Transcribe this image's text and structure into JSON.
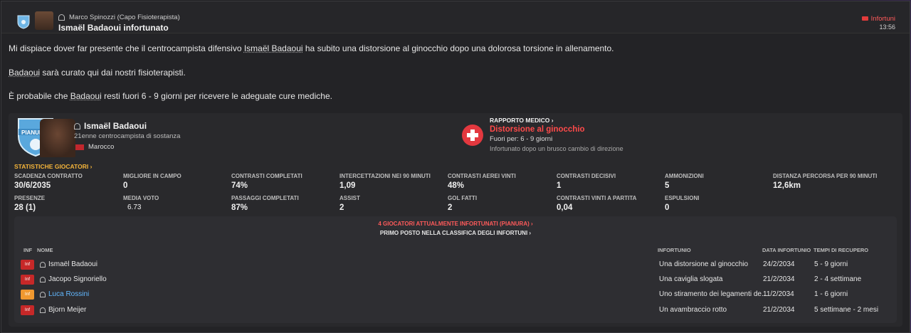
{
  "header": {
    "sender": "Marco Spinozzi  (Capo Fisioterapista)",
    "subject": "Ismaël Badaoui infortunato",
    "tag": "Infortuni",
    "time": "13:56"
  },
  "body": {
    "line1_a": "Mi dispiace dover far presente che il centrocampista difensivo ",
    "line1_name": "Ismaël Badaoui",
    "line1_b": " ha subito una distorsione al ginocchio dopo una dolorosa torsione in allenamento.",
    "line2_name": "Badaoui",
    "line2_b": " sarà curato qui dai nostri fisioterapisti.",
    "line3_a": "È probabile che ",
    "line3_name": "Badaoui",
    "line3_b": " resti fuori 6 - 9 giorni per ricevere le adeguate cure mediche."
  },
  "player": {
    "name": "Ismaël Badaoui",
    "description": "21enne centrocampista di sostanza",
    "nationality": "Marocco",
    "badge_text": "PIANURA"
  },
  "medical": {
    "title": "RAPPORTO MEDICO",
    "injury": "Distorsione al ginocchio",
    "out_for": "Fuori per: 6 - 9 giorni",
    "how": "Infortunato dopo un brusco cambio di direzione"
  },
  "stats": {
    "title": "STATISTICHE GIOCATORI",
    "items": [
      {
        "label": "SCADENZA CONTRATTO",
        "value": "30/6/2035"
      },
      {
        "label": "MIGLIORE IN CAMPO",
        "value": "0"
      },
      {
        "label": "CONTRASTI COMPLETATI",
        "value": "74%"
      },
      {
        "label": "INTERCETTAZIONI NEI 90 MINUTI",
        "value": "1,09"
      },
      {
        "label": "CONTRASTI AEREI VINTI",
        "value": "48%"
      },
      {
        "label": "CONTRASTI DECISIVI",
        "value": "1"
      },
      {
        "label": "AMMONIZIONI",
        "value": "5"
      },
      {
        "label": "DISTANZA PERCORSA PER 90 MINUTI",
        "value": "12,6km"
      },
      {
        "label": "PRESENZE",
        "value": "28 (1)"
      },
      {
        "label": "MEDIA VOTO",
        "value": "6.73"
      },
      {
        "label": "PASSAGGI COMPLETATI",
        "value": "87%"
      },
      {
        "label": "ASSIST",
        "value": "2"
      },
      {
        "label": "GOL FATTI",
        "value": "2"
      },
      {
        "label": "CONTRASTI VINTI A PARTITA",
        "value": "0,04"
      },
      {
        "label": "ESPULSIONI",
        "value": "0"
      }
    ]
  },
  "injuries": {
    "headline": "4 GIOCATORI ATTUALMENTE INFORTUNATI (PIANURA)",
    "subheadline": "PRIMO POSTO NELLA CLASSIFICA DEGLI INFORTUNI",
    "columns": {
      "inf": "INF",
      "name": "NOME",
      "injury": "INFORTUNIO",
      "date": "DATA INFORTUNIO",
      "recovery": "TEMPI DI RECUPERO"
    },
    "rows": [
      {
        "badge": "Inf",
        "badge_color": "#c62828",
        "name": "Ismaël Badaoui",
        "injury": "Una distorsione al ginocchio",
        "date": "24/2/2034",
        "recovery": "5 - 9 giorni"
      },
      {
        "badge": "Inf",
        "badge_color": "#c62828",
        "name": "Jacopo Signoriello",
        "injury": "Una caviglia slogata",
        "date": "21/2/2034",
        "recovery": "2 - 4 settimane"
      },
      {
        "badge": "Inf",
        "badge_color": "#f0982f",
        "name": "Luca Rossini",
        "injury": "Uno stiramento dei legamenti de...",
        "date": "11/2/2034",
        "recovery": "1 - 6 giorni"
      },
      {
        "badge": "Inf",
        "badge_color": "#c62828",
        "name": "Bjorn Meijer",
        "injury": "Un avambraccio rotto",
        "date": "21/2/2034",
        "recovery": "5 settimane - 2 mesi"
      }
    ]
  },
  "colors": {
    "accent_red": "#ff4a4a",
    "accent_orange": "#f4b43a",
    "link": "#62b8ff"
  }
}
